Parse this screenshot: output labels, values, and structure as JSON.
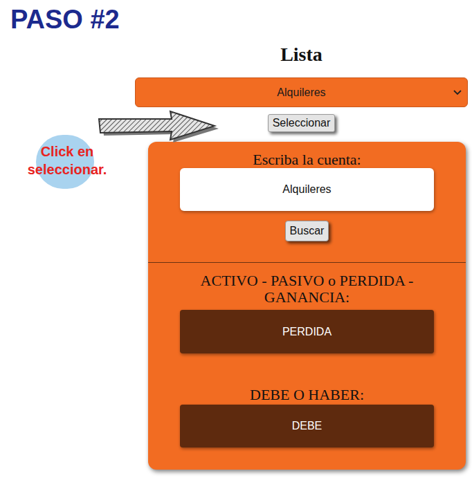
{
  "step": {
    "title": "PASO #2"
  },
  "list": {
    "title": "Lista",
    "dropdown_value": "Alquileres",
    "select_button": "Seleccionar"
  },
  "annotation": {
    "text": "Click en seleccionar."
  },
  "panel": {
    "account_label": "Escriba la cuenta:",
    "account_value": "Alquileres",
    "search_button": "Buscar",
    "type_label": "ACTIVO - PASIVO o PERDIDA - GANANCIA:",
    "type_value": "PERDIDA",
    "side_label": "DEBE O HABER:",
    "side_value": "DEBE"
  }
}
